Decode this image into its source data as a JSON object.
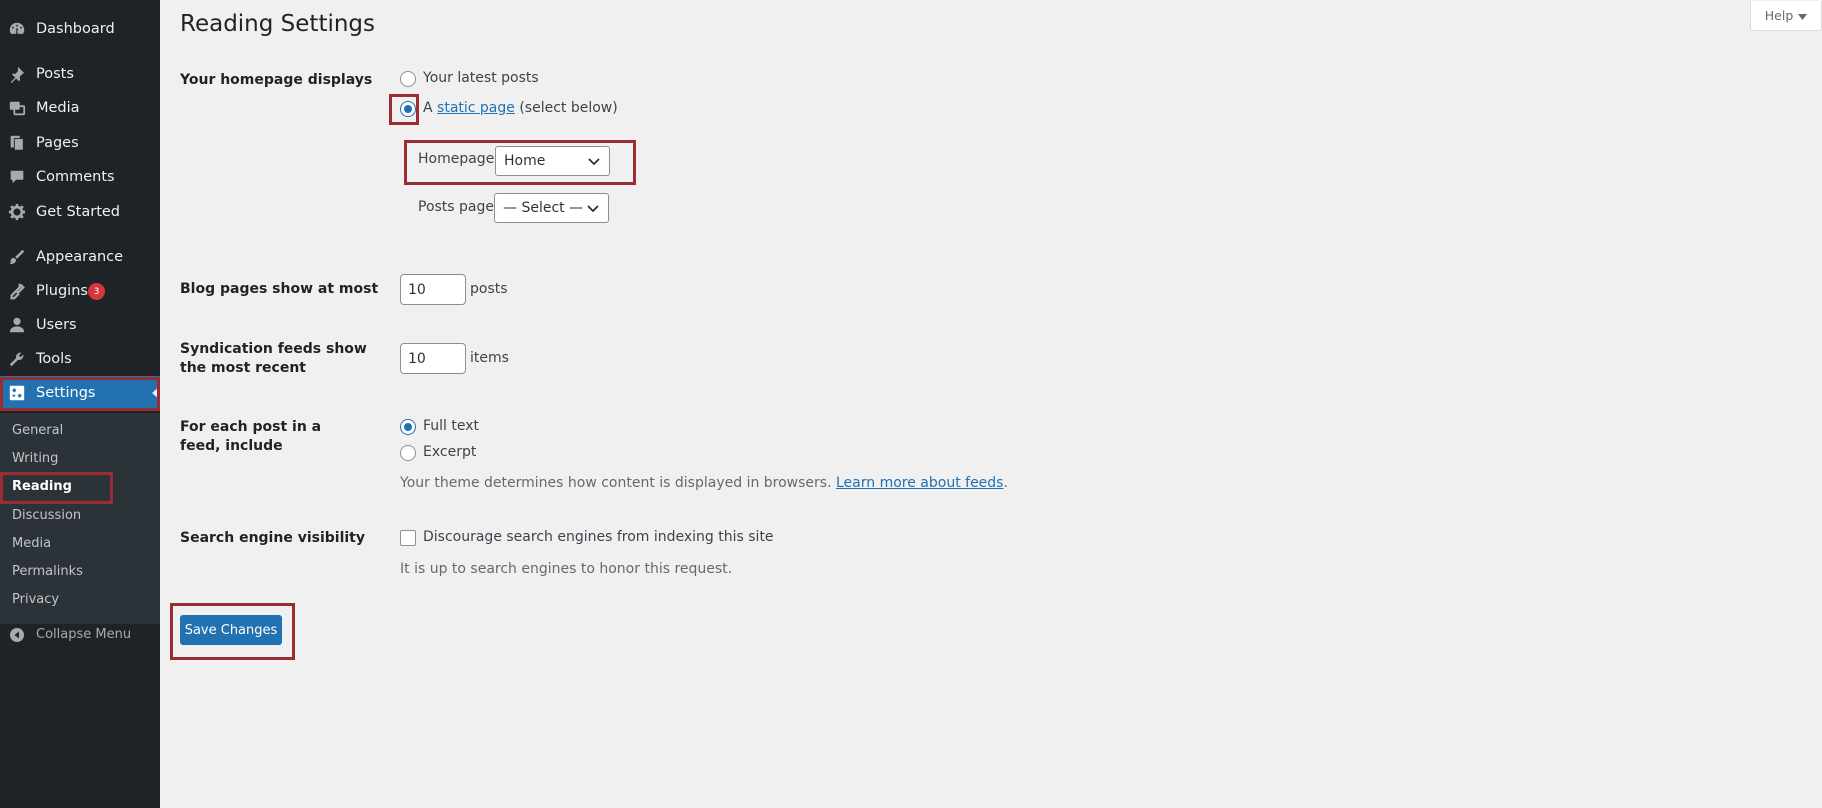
{
  "sidebar": {
    "items": [
      {
        "label": "Dashboard",
        "icon": "dashboard-icon"
      },
      {
        "label": "Posts",
        "icon": "pin-icon"
      },
      {
        "label": "Media",
        "icon": "media-icon"
      },
      {
        "label": "Pages",
        "icon": "pages-icon"
      },
      {
        "label": "Comments",
        "icon": "comments-icon"
      },
      {
        "label": "Get Started",
        "icon": "gear-icon"
      },
      {
        "label": "Appearance",
        "icon": "paintbrush-icon"
      },
      {
        "label": "Plugins",
        "icon": "plug-icon",
        "badge": "3"
      },
      {
        "label": "Users",
        "icon": "user-icon"
      },
      {
        "label": "Tools",
        "icon": "wrench-icon"
      },
      {
        "label": "Settings",
        "icon": "settings-icon",
        "active": true
      }
    ],
    "submenu": [
      "General",
      "Writing",
      "Reading",
      "Discussion",
      "Media",
      "Permalinks",
      "Privacy"
    ],
    "current_sub": "Reading",
    "collapse_label": "Collapse Menu"
  },
  "header": {
    "title": "Reading Settings",
    "help_label": "Help"
  },
  "form": {
    "homepage_displays": {
      "label": "Your homepage displays",
      "option_latest": "Your latest posts",
      "option_static_prefix": "A",
      "option_static_link": "static page",
      "option_static_suffix": "(select below)",
      "selected": "static"
    },
    "homepage_select": {
      "label": "Homepage:",
      "value": "Home"
    },
    "posts_page_select": {
      "label": "Posts page:",
      "value": "— Select —"
    },
    "blog_pages": {
      "label": "Blog pages show at most",
      "value": "10",
      "unit": "posts"
    },
    "syndication": {
      "label": "Syndication feeds show the most recent",
      "value": "10",
      "unit": "items"
    },
    "feed_include": {
      "label": "For each post in a feed, include",
      "option_full": "Full text",
      "option_excerpt": "Excerpt",
      "selected": "full",
      "desc_prefix": "Your theme determines how content is displayed in browsers.",
      "desc_link": "Learn more about feeds",
      "desc_suffix": "."
    },
    "search_visibility": {
      "label": "Search engine visibility",
      "checkbox_label": "Discourage search engines from indexing this site",
      "checked": false,
      "desc": "It is up to search engines to honor this request."
    },
    "save_label": "Save Changes"
  },
  "colors": {
    "sidebar_bg": "#1d2327",
    "accent": "#2271b1",
    "highlight": "#9b2c33",
    "badge": "#d63638"
  }
}
